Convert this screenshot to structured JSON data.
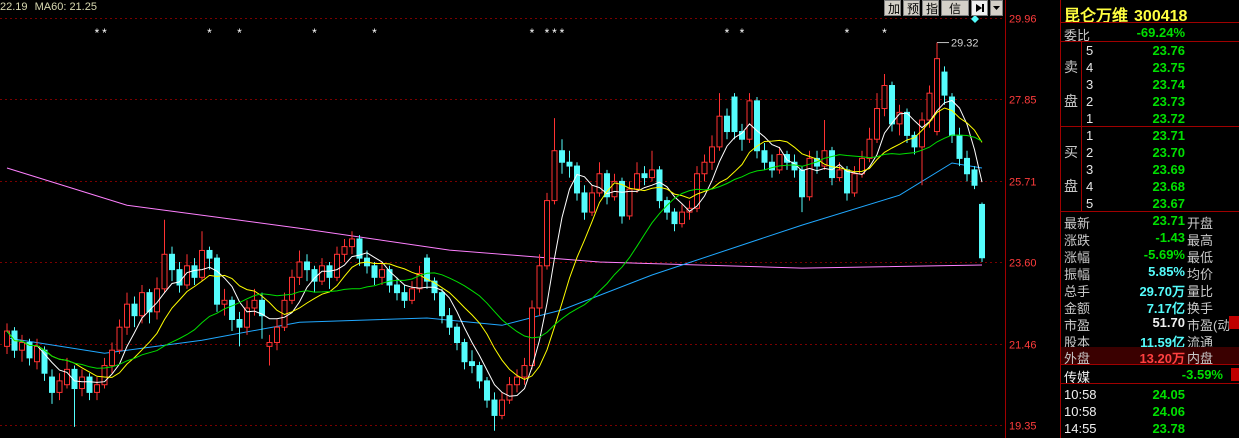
{
  "header": {
    "last": "22.19",
    "ma60": "MA60: 21.25"
  },
  "toolbar": {
    "buttons": [
      "加",
      "预",
      "指",
      "信息"
    ]
  },
  "chart_data": {
    "type": "candlestick",
    "y_ticks": [
      "29.96",
      "27.85",
      "25.71",
      "23.60",
      "21.46",
      "19.35"
    ],
    "ylim": [
      19.35,
      29.96
    ],
    "up_color": "#ff3232",
    "down_color": "#54fcfc",
    "grid_color": "#7a0000",
    "tick_color": "#ff3c3c",
    "ma_colors": [
      "#ffffff",
      "#ffff00",
      "#00e000"
    ],
    "extra_lines": [
      {
        "color": "#ff80ff",
        "points": [
          [
            0,
            26.05
          ],
          [
            16,
            25.08
          ],
          [
            39,
            24.48
          ],
          [
            59,
            23.91
          ],
          [
            79,
            23.6
          ],
          [
            106,
            23.44
          ],
          [
            130,
            23.52
          ]
        ]
      },
      {
        "color": "#20a8ff",
        "points": [
          [
            0,
            21.62
          ],
          [
            13,
            21.22
          ],
          [
            26,
            21.56
          ],
          [
            39,
            22.03
          ],
          [
            56,
            22.14
          ],
          [
            66,
            21.95
          ],
          [
            74,
            22.35
          ],
          [
            86,
            23.26
          ],
          [
            106,
            24.56
          ],
          [
            119,
            25.34
          ],
          [
            126,
            26.18
          ],
          [
            130,
            26.05
          ]
        ]
      }
    ],
    "markers": {
      "symbol": "*",
      "indices": [
        12,
        13,
        27,
        31,
        41,
        49,
        70,
        72,
        73,
        74,
        96,
        98,
        112,
        117
      ]
    },
    "annotation": {
      "index": 124,
      "value": "29.32"
    },
    "candles": [
      [
        21.4,
        22.0,
        21.2,
        21.8
      ],
      [
        21.8,
        21.9,
        21.1,
        21.3
      ],
      [
        21.3,
        21.7,
        21.0,
        21.5
      ],
      [
        21.5,
        21.6,
        20.9,
        21.1
      ],
      [
        21.0,
        21.6,
        20.8,
        21.4
      ],
      [
        21.3,
        21.4,
        20.5,
        20.7
      ],
      [
        20.6,
        20.8,
        19.9,
        20.2
      ],
      [
        20.2,
        20.7,
        20.0,
        20.5
      ],
      [
        20.4,
        21.1,
        20.3,
        20.8
      ],
      [
        20.8,
        20.9,
        19.3,
        20.3
      ],
      [
        20.3,
        20.8,
        20.1,
        20.6
      ],
      [
        20.6,
        20.7,
        20.0,
        20.2
      ],
      [
        20.2,
        20.6,
        20.0,
        20.4
      ],
      [
        20.4,
        21.1,
        20.3,
        20.9
      ],
      [
        20.9,
        21.5,
        20.7,
        21.3
      ],
      [
        21.3,
        22.1,
        21.2,
        21.9
      ],
      [
        21.9,
        22.8,
        21.7,
        22.5
      ],
      [
        22.5,
        22.7,
        21.9,
        22.2
      ],
      [
        22.2,
        23.0,
        22.0,
        22.8
      ],
      [
        22.8,
        22.9,
        22.0,
        22.3
      ],
      [
        22.3,
        23.2,
        22.1,
        22.9
      ],
      [
        22.9,
        24.7,
        22.8,
        23.8
      ],
      [
        23.8,
        24.0,
        23.1,
        23.4
      ],
      [
        23.4,
        23.6,
        22.8,
        23.0
      ],
      [
        23.0,
        23.8,
        22.9,
        23.5
      ],
      [
        23.5,
        23.7,
        23.0,
        23.2
      ],
      [
        23.2,
        24.4,
        23.1,
        23.9
      ],
      [
        23.9,
        24.0,
        23.4,
        23.7
      ],
      [
        23.7,
        23.8,
        22.3,
        22.5
      ],
      [
        22.5,
        22.9,
        22.2,
        22.6
      ],
      [
        22.6,
        22.7,
        21.8,
        22.1
      ],
      [
        22.1,
        22.3,
        21.4,
        21.9
      ],
      [
        21.9,
        22.6,
        21.7,
        22.4
      ],
      [
        22.4,
        22.9,
        22.2,
        22.6
      ],
      [
        22.6,
        22.8,
        21.6,
        22.2
      ],
      [
        21.4,
        21.7,
        20.9,
        21.5
      ],
      [
        21.5,
        22.1,
        21.3,
        21.9
      ],
      [
        21.9,
        22.8,
        21.8,
        22.6
      ],
      [
        22.6,
        23.4,
        22.5,
        23.2
      ],
      [
        23.2,
        23.9,
        23.0,
        23.6
      ],
      [
        23.6,
        23.8,
        23.1,
        23.4
      ],
      [
        23.4,
        23.5,
        22.8,
        23.1
      ],
      [
        23.1,
        23.7,
        23.0,
        23.5
      ],
      [
        23.5,
        23.6,
        22.9,
        23.2
      ],
      [
        23.2,
        24.0,
        23.1,
        23.8
      ],
      [
        23.8,
        24.2,
        23.6,
        24.0
      ],
      [
        24.0,
        24.4,
        23.8,
        24.2
      ],
      [
        24.2,
        24.3,
        23.5,
        23.7
      ],
      [
        23.7,
        23.9,
        23.3,
        23.5
      ],
      [
        23.5,
        23.6,
        23.0,
        23.2
      ],
      [
        23.2,
        23.6,
        23.0,
        23.4
      ],
      [
        23.4,
        23.5,
        22.8,
        23.0
      ],
      [
        23.0,
        23.2,
        22.6,
        22.8
      ],
      [
        22.8,
        23.0,
        22.4,
        22.6
      ],
      [
        22.6,
        23.1,
        22.5,
        22.9
      ],
      [
        22.9,
        23.5,
        22.8,
        23.3
      ],
      [
        23.7,
        23.8,
        22.9,
        23.1
      ],
      [
        23.1,
        23.2,
        22.6,
        22.8
      ],
      [
        22.8,
        22.9,
        22.0,
        22.2
      ],
      [
        22.2,
        22.4,
        21.7,
        21.9
      ],
      [
        21.9,
        22.0,
        21.3,
        21.5
      ],
      [
        21.5,
        21.6,
        20.8,
        21.0
      ],
      [
        21.0,
        21.3,
        20.7,
        20.9
      ],
      [
        20.9,
        21.0,
        20.3,
        20.5
      ],
      [
        20.5,
        20.6,
        19.8,
        20.0
      ],
      [
        20.0,
        20.2,
        19.2,
        19.6
      ],
      [
        19.6,
        20.2,
        19.5,
        20.0
      ],
      [
        20.0,
        20.6,
        19.9,
        20.4
      ],
      [
        20.4,
        20.8,
        20.2,
        20.6
      ],
      [
        20.6,
        21.1,
        20.4,
        20.9
      ],
      [
        20.9,
        22.6,
        20.8,
        22.4
      ],
      [
        22.4,
        23.8,
        22.2,
        23.5
      ],
      [
        23.5,
        25.4,
        23.4,
        25.2
      ],
      [
        25.2,
        27.35,
        25.1,
        26.5
      ],
      [
        26.5,
        26.8,
        25.9,
        26.2
      ],
      [
        26.2,
        26.5,
        25.8,
        26.1
      ],
      [
        26.1,
        26.2,
        25.2,
        25.4
      ],
      [
        25.4,
        25.6,
        24.7,
        24.9
      ],
      [
        24.9,
        25.6,
        24.8,
        25.4
      ],
      [
        25.4,
        26.2,
        25.3,
        25.9
      ],
      [
        25.9,
        26.0,
        25.1,
        25.3
      ],
      [
        25.3,
        25.9,
        25.2,
        25.7
      ],
      [
        25.7,
        25.8,
        24.6,
        24.8
      ],
      [
        24.8,
        25.7,
        24.7,
        25.5
      ],
      [
        25.5,
        26.2,
        25.4,
        25.9
      ],
      [
        25.9,
        26.1,
        25.6,
        25.8
      ],
      [
        25.8,
        26.5,
        25.7,
        26.0
      ],
      [
        26.0,
        26.1,
        25.0,
        25.2
      ],
      [
        25.2,
        25.3,
        24.7,
        24.9
      ],
      [
        24.9,
        25.0,
        24.4,
        24.6
      ],
      [
        24.6,
        25.1,
        24.5,
        24.9
      ],
      [
        24.9,
        25.2,
        24.7,
        25.0
      ],
      [
        25.0,
        26.1,
        24.9,
        25.9
      ],
      [
        25.9,
        26.4,
        25.7,
        26.2
      ],
      [
        26.2,
        26.9,
        26.0,
        26.6
      ],
      [
        26.6,
        28.0,
        26.5,
        27.4
      ],
      [
        27.4,
        27.6,
        26.8,
        27.0
      ],
      [
        27.9,
        28.0,
        26.8,
        27.0
      ],
      [
        27.0,
        27.2,
        26.5,
        26.8
      ],
      [
        26.8,
        28.0,
        26.7,
        27.8
      ],
      [
        27.8,
        27.9,
        26.3,
        26.5
      ],
      [
        26.5,
        26.7,
        26.0,
        26.2
      ],
      [
        26.2,
        26.4,
        25.8,
        26.0
      ],
      [
        26.0,
        26.6,
        25.9,
        26.4
      ],
      [
        26.4,
        26.5,
        26.0,
        26.2
      ],
      [
        26.2,
        26.4,
        25.8,
        26.0
      ],
      [
        26.0,
        26.1,
        24.9,
        25.3
      ],
      [
        25.3,
        26.5,
        25.2,
        26.3
      ],
      [
        26.3,
        26.5,
        25.9,
        26.1
      ],
      [
        26.1,
        27.3,
        26.0,
        26.5
      ],
      [
        26.5,
        26.6,
        25.6,
        25.8
      ],
      [
        25.8,
        26.2,
        25.7,
        26.0
      ],
      [
        26.0,
        26.1,
        25.2,
        25.4
      ],
      [
        25.4,
        26.1,
        25.3,
        25.9
      ],
      [
        25.9,
        26.5,
        25.8,
        26.3
      ],
      [
        26.3,
        27.1,
        26.2,
        26.8
      ],
      [
        26.8,
        28.0,
        26.7,
        27.6
      ],
      [
        27.6,
        28.5,
        27.4,
        28.2
      ],
      [
        28.2,
        28.3,
        27.0,
        27.2
      ],
      [
        27.2,
        27.7,
        26.9,
        27.5
      ],
      [
        27.5,
        27.6,
        26.7,
        26.9
      ],
      [
        26.9,
        27.0,
        26.4,
        26.6
      ],
      [
        26.6,
        27.5,
        25.6,
        27.3
      ],
      [
        27.3,
        28.2,
        27.1,
        28.0
      ],
      [
        27.0,
        29.32,
        26.9,
        28.9
      ],
      [
        28.55,
        28.7,
        27.7,
        27.95
      ],
      [
        27.9,
        28.0,
        26.7,
        26.9
      ],
      [
        26.9,
        27.1,
        26.1,
        26.3
      ],
      [
        26.3,
        26.5,
        25.7,
        25.9
      ],
      [
        26.0,
        26.1,
        25.5,
        25.6
      ],
      [
        25.1,
        25.15,
        23.6,
        23.71
      ]
    ]
  },
  "quote": {
    "name": "昆仑万维",
    "code": "300418",
    "weibi_label": "委比",
    "weibi_value": "-69.24%",
    "sell_side": [
      "卖",
      "盘"
    ],
    "buy_side": [
      "买",
      "盘"
    ],
    "sell": [
      {
        "level": "5",
        "price": "23.76"
      },
      {
        "level": "4",
        "price": "23.75"
      },
      {
        "level": "3",
        "price": "23.74"
      },
      {
        "level": "2",
        "price": "23.73"
      },
      {
        "level": "1",
        "price": "23.72"
      }
    ],
    "buy": [
      {
        "level": "1",
        "price": "23.71"
      },
      {
        "level": "2",
        "price": "23.70"
      },
      {
        "level": "3",
        "price": "23.69"
      },
      {
        "level": "4",
        "price": "23.68"
      },
      {
        "level": "5",
        "price": "23.67"
      }
    ],
    "stats": [
      {
        "label": "最新",
        "value": "23.71",
        "value_color": "#00e000",
        "label2": "开盘"
      },
      {
        "label": "涨跌",
        "value": "-1.43",
        "value_color": "#00e000",
        "label2": "最高"
      },
      {
        "label": "涨幅",
        "value": "-5.69%",
        "value_color": "#00e000",
        "label2": "最低"
      },
      {
        "label": "振幅",
        "value": "5.85%",
        "value_color": "#54fcfc",
        "label2": "均价"
      },
      {
        "label": "总手",
        "value": "29.70万",
        "value_color": "#54fcfc",
        "label2": "量比"
      },
      {
        "label": "金额",
        "value": "7.17亿",
        "value_color": "#54fcfc",
        "label2": "换手"
      },
      {
        "label": "市盈",
        "value": "51.70",
        "value_color": "#f0f0f0",
        "label2": "市盈(动"
      },
      {
        "label": "股本",
        "value": "11.59亿",
        "value_color": "#54fcfc",
        "label2": "流通"
      },
      {
        "label": "外盘",
        "value": "13.20万",
        "value_color": "#ff4040",
        "label2": "内盘"
      }
    ],
    "sector": {
      "name": "传媒",
      "change": "-3.59%"
    },
    "ticks": [
      {
        "time": "10:58",
        "price": "24.05"
      },
      {
        "time": "10:58",
        "price": "24.06"
      },
      {
        "time": "14:55",
        "price": "23.78"
      }
    ]
  }
}
